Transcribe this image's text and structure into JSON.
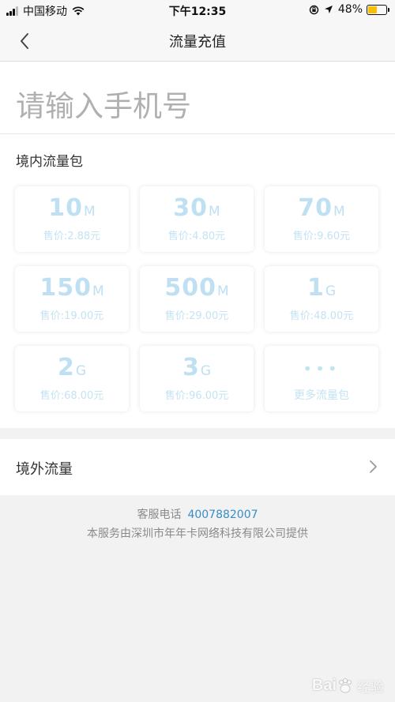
{
  "status_bar": {
    "carrier": "中国移动",
    "time": "下午12:35",
    "battery": "48%",
    "battery_level": 0.48,
    "battery_color": "#f6c000"
  },
  "nav": {
    "title": "流量充值",
    "back_icon": "chevron-left-icon"
  },
  "phone": {
    "placeholder": "请输入手机号",
    "value": ""
  },
  "domestic": {
    "title": "境内流量包",
    "packages": [
      {
        "amount": "10",
        "unit": "M",
        "price": "售价:2.88元"
      },
      {
        "amount": "30",
        "unit": "M",
        "price": "售价:4.80元"
      },
      {
        "amount": "70",
        "unit": "M",
        "price": "售价:9.60元"
      },
      {
        "amount": "150",
        "unit": "M",
        "price": "售价:19.00元"
      },
      {
        "amount": "500",
        "unit": "M",
        "price": "售价:29.00元"
      },
      {
        "amount": "1",
        "unit": "G",
        "price": "售价:48.00元"
      },
      {
        "amount": "2",
        "unit": "G",
        "price": "售价:68.00元"
      },
      {
        "amount": "3",
        "unit": "G",
        "price": "售价:96.00元"
      }
    ],
    "more": {
      "dots": "•••",
      "label": "更多流量包"
    }
  },
  "overseas": {
    "label": "境外流量",
    "icon": "chevron-right-icon"
  },
  "footer": {
    "hotline_label": "客服电话",
    "hotline_number": "4007882007",
    "provider": "本服务由深圳市年年卡网络科技有限公司提供"
  },
  "watermark": {
    "brand": "Bai",
    "suffix": "经验"
  },
  "colors": {
    "accent": "#3a8cc6",
    "package_text": "#bfe0f2",
    "background": "#f2f2f2"
  }
}
